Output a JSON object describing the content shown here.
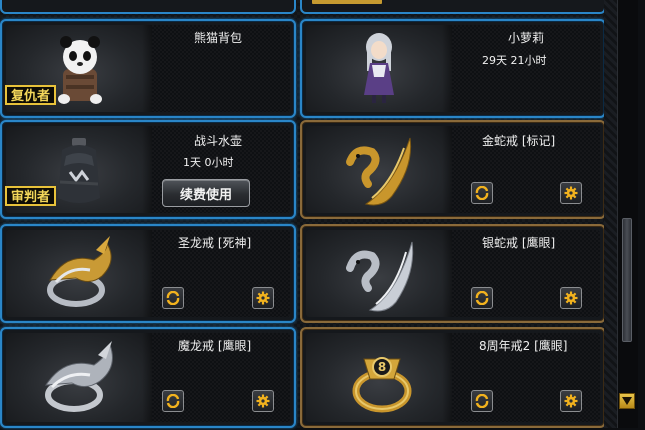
{
  "items": [
    {
      "name": "熊猫背包",
      "duration": "",
      "badge": "复仇者",
      "border": "blue",
      "icon": "panda-backpack-icon"
    },
    {
      "name": "小萝莉",
      "duration": "29天  21小时",
      "badge": "",
      "border": "blue",
      "icon": "loli-doll-icon"
    },
    {
      "name": "战斗水壶",
      "duration": "1天  0小时",
      "badge": "审判者",
      "border": "blue",
      "icon": "water-flask-icon",
      "renew_label": "续费使用"
    },
    {
      "name": "金蛇戒 [标记]",
      "duration": "",
      "badge": "",
      "border": "gold",
      "icon": "gold-snake-ring-icon"
    },
    {
      "name": "圣龙戒 [死神]",
      "duration": "",
      "badge": "",
      "border": "blue",
      "icon": "holy-dragon-ring-icon"
    },
    {
      "name": "银蛇戒 [鹰眼]",
      "duration": "",
      "badge": "",
      "border": "gold",
      "icon": "silver-snake-ring-icon"
    },
    {
      "name": "魔龙戒 [鹰眼]",
      "duration": "",
      "badge": "",
      "border": "blue",
      "icon": "demon-dragon-ring-icon"
    },
    {
      "name": "8周年戒2 [鹰眼]",
      "duration": "",
      "badge": "",
      "border": "gold",
      "icon": "anniversary-ring-icon"
    }
  ],
  "colors": {
    "blue_border": "#2a86c8",
    "gold_border": "#8a6a3a",
    "badge": "#e8c23a"
  }
}
